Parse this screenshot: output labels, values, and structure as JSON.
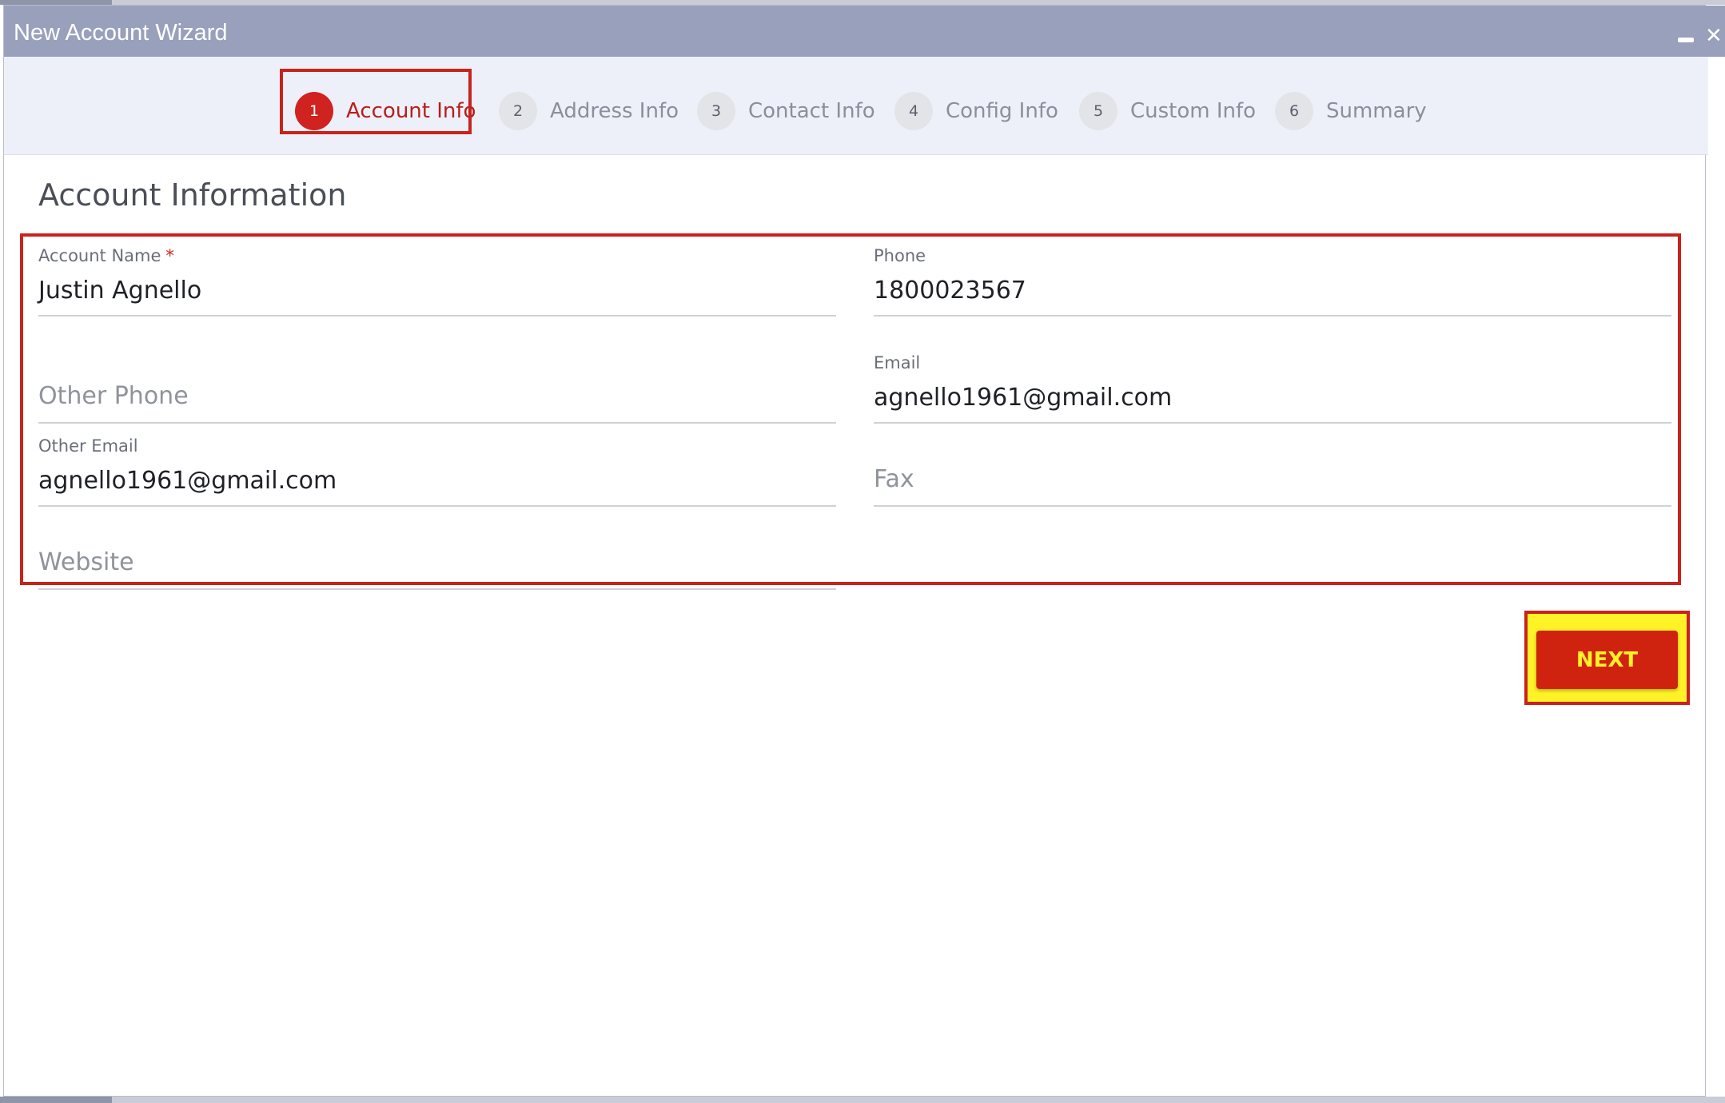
{
  "window": {
    "title": "New Account Wizard",
    "minimize_icon": "minimize-icon",
    "close_icon": "close-icon",
    "close_glyph": "✕"
  },
  "steps": [
    {
      "number": "1",
      "label": "Account Info",
      "active": true
    },
    {
      "number": "2",
      "label": "Address Info",
      "active": false
    },
    {
      "number": "3",
      "label": "Contact Info",
      "active": false
    },
    {
      "number": "4",
      "label": "Config Info",
      "active": false
    },
    {
      "number": "5",
      "label": "Custom Info",
      "active": false
    },
    {
      "number": "6",
      "label": "Summary",
      "active": false
    }
  ],
  "section": {
    "title": "Account Information"
  },
  "form": {
    "account_name": {
      "label": "Account Name",
      "required_mark": "*",
      "value": "Justin Agnello"
    },
    "phone": {
      "label": "Phone",
      "value": "1800023567"
    },
    "other_phone": {
      "placeholder": "Other Phone",
      "value": ""
    },
    "email": {
      "label": "Email",
      "value": "agnello1961@gmail.com"
    },
    "other_email": {
      "label": "Other Email",
      "value": "agnello1961@gmail.com"
    },
    "fax": {
      "placeholder": "Fax",
      "value": ""
    },
    "website": {
      "placeholder": "Website",
      "value": ""
    }
  },
  "actions": {
    "next_label": "NEXT"
  },
  "colors": {
    "titlebar": "#99a0bb",
    "accent_red": "#d0231f",
    "highlight_yellow": "#fff227",
    "stepper_bg": "#eef0f9"
  }
}
